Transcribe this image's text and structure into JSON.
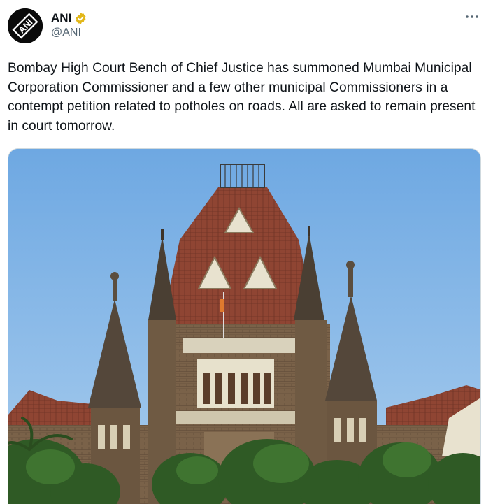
{
  "author": {
    "display_name": "ANI",
    "handle": "@ANI",
    "avatar_logo_text": "ANI",
    "verified_badge": "gold-check-badge-icon",
    "verified_color": "#e2b719"
  },
  "menu": {
    "icon": "more-horizontal-icon"
  },
  "tweet": {
    "text": "Bombay High Court Bench of Chief Justice has summoned Mumbai Municipal Corporation Commissioner and a few other municipal Commissioners in a contempt petition related to potholes on roads. All are asked to remain present in court tomorrow."
  },
  "media": {
    "kind": "photo",
    "subject": "Bombay High Court building"
  },
  "colors": {
    "text": "#0f1419",
    "secondary": "#536471",
    "border": "#cfd9de"
  }
}
